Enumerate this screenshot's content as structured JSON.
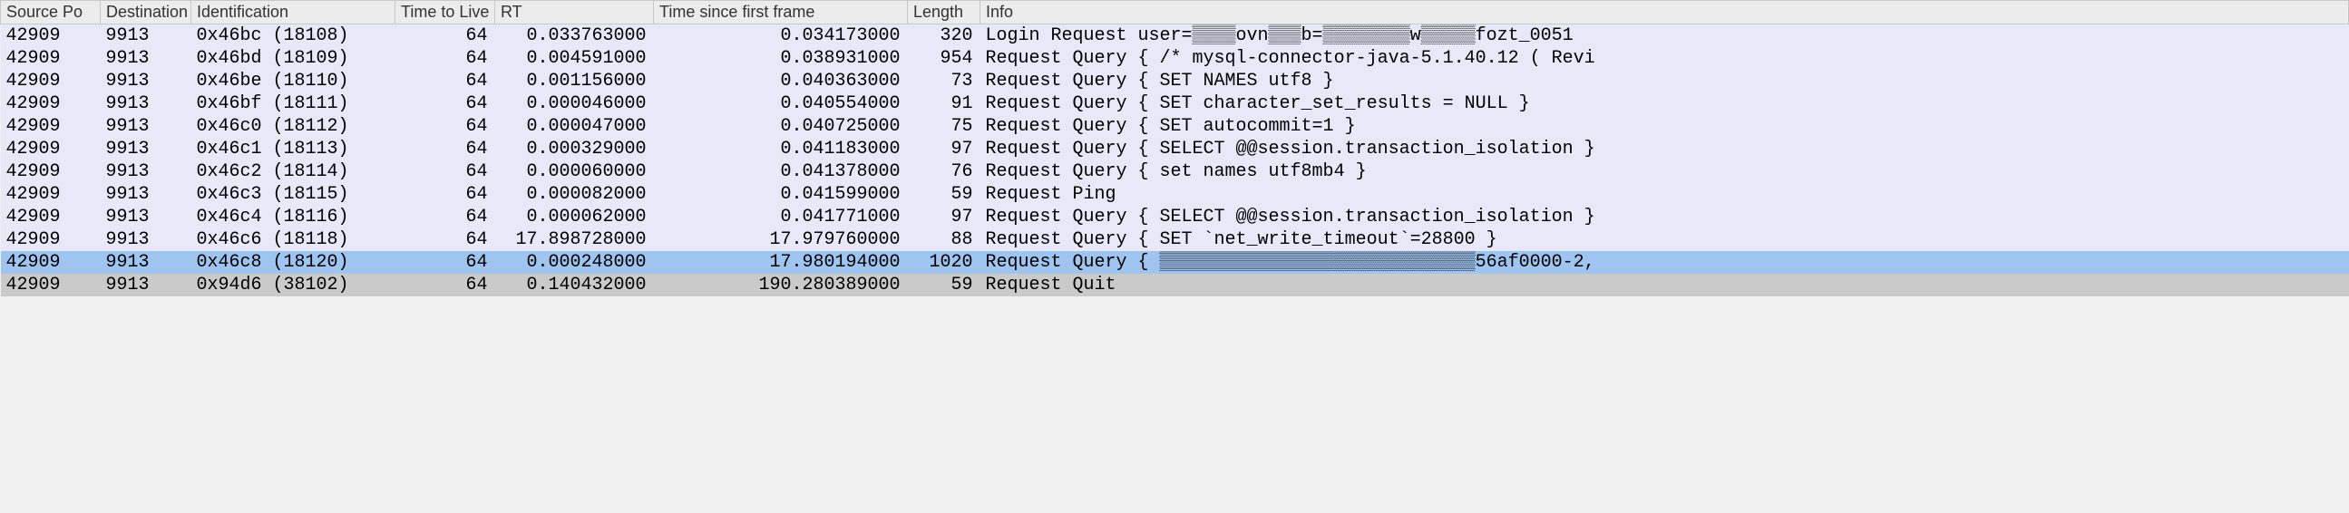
{
  "columns": {
    "srcport": "Source Po",
    "dstport": "Destination",
    "ident": "Identification",
    "ttl": "Time to Live",
    "rt": "RT",
    "tsff": "Time since first frame",
    "length": "Length",
    "info": "Info"
  },
  "rows": [
    {
      "srcport": "42909",
      "dstport": "9913",
      "ident": "0x46bc (18108)",
      "ttl": "64",
      "rt": " 0.033763000",
      "tsff": "  0.034173000",
      "length": "320",
      "info": "Login Request user=▒▒▒▒ovn▒▒▒b=▒▒▒▒▒▒▒▒w▒▒▒▒▒fozt_0051",
      "bg": "bg-lavender"
    },
    {
      "srcport": "42909",
      "dstport": "9913",
      "ident": "0x46bd (18109)",
      "ttl": "64",
      "rt": " 0.004591000",
      "tsff": "  0.038931000",
      "length": "954",
      "info": "Request Query { /* mysql-connector-java-5.1.40.12 ( Revi",
      "bg": "bg-lavender"
    },
    {
      "srcport": "42909",
      "dstport": "9913",
      "ident": "0x46be (18110)",
      "ttl": "64",
      "rt": " 0.001156000",
      "tsff": "  0.040363000",
      "length": "73",
      "info": "Request Query { SET NAMES utf8 }",
      "bg": "bg-lavender"
    },
    {
      "srcport": "42909",
      "dstport": "9913",
      "ident": "0x46bf (18111)",
      "ttl": "64",
      "rt": " 0.000046000",
      "tsff": "  0.040554000",
      "length": "91",
      "info": "Request Query { SET character_set_results = NULL }",
      "bg": "bg-lavender"
    },
    {
      "srcport": "42909",
      "dstport": "9913",
      "ident": "0x46c0 (18112)",
      "ttl": "64",
      "rt": " 0.000047000",
      "tsff": "  0.040725000",
      "length": "75",
      "info": "Request Query { SET autocommit=1 }",
      "bg": "bg-lavender"
    },
    {
      "srcport": "42909",
      "dstport": "9913",
      "ident": "0x46c1 (18113)",
      "ttl": "64",
      "rt": " 0.000329000",
      "tsff": "  0.041183000",
      "length": "97",
      "info": "Request Query { SELECT @@session.transaction_isolation }",
      "bg": "bg-lavender"
    },
    {
      "srcport": "42909",
      "dstport": "9913",
      "ident": "0x46c2 (18114)",
      "ttl": "64",
      "rt": " 0.000060000",
      "tsff": "  0.041378000",
      "length": "76",
      "info": "Request Query { set names utf8mb4 }",
      "bg": "bg-lavender"
    },
    {
      "srcport": "42909",
      "dstport": "9913",
      "ident": "0x46c3 (18115)",
      "ttl": "64",
      "rt": " 0.000082000",
      "tsff": "  0.041599000",
      "length": "59",
      "info": "Request Ping",
      "bg": "bg-lavender"
    },
    {
      "srcport": "42909",
      "dstport": "9913",
      "ident": "0x46c4 (18116)",
      "ttl": "64",
      "rt": " 0.000062000",
      "tsff": "  0.041771000",
      "length": "97",
      "info": "Request Query { SELECT @@session.transaction_isolation }",
      "bg": "bg-lavender"
    },
    {
      "srcport": "42909",
      "dstport": "9913",
      "ident": "0x46c6 (18118)",
      "ttl": "64",
      "rt": "17.898728000",
      "tsff": " 17.979760000",
      "length": "88",
      "info": "Request Query { SET `net_write_timeout`=28800 }",
      "bg": "bg-lavender"
    },
    {
      "srcport": "42909",
      "dstport": "9913",
      "ident": "0x46c8 (18120)",
      "ttl": "64",
      "rt": " 0.000248000",
      "tsff": " 17.980194000",
      "length": "1020",
      "info": "Request Query { ▒▒▒▒▒▒▒▒▒▒▒▒▒▒▒▒▒▒▒▒▒▒▒▒▒▒▒▒▒56af0000-2,",
      "bg": "bg-selected"
    },
    {
      "srcport": "42909",
      "dstport": "9913",
      "ident": "0x94d6 (38102)",
      "ttl": "64",
      "rt": " 0.140432000",
      "tsff": "190.280389000",
      "length": "59",
      "info": "Request Quit",
      "bg": "bg-gray"
    }
  ]
}
